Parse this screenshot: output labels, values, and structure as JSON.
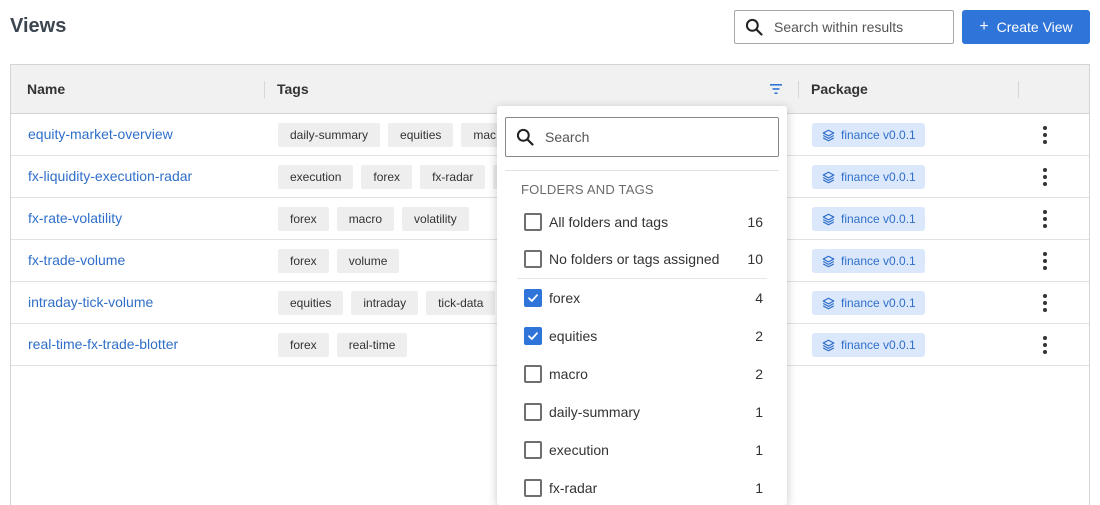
{
  "page": {
    "title": "Views"
  },
  "search": {
    "placeholder": "Search within results"
  },
  "create_button": {
    "label": "Create View",
    "plus": "+"
  },
  "table": {
    "columns": {
      "name": "Name",
      "tags": "Tags",
      "package": "Package"
    },
    "rows": [
      {
        "name": "equity-market-overview",
        "tags": [
          "daily-summary",
          "equities",
          "mac"
        ],
        "package": "finance v0.0.1"
      },
      {
        "name": "fx-liquidity-execution-radar",
        "tags": [
          "execution",
          "forex",
          "fx-radar",
          ""
        ],
        "package": "finance v0.0.1"
      },
      {
        "name": "fx-rate-volatility",
        "tags": [
          "forex",
          "macro",
          "volatility"
        ],
        "package": "finance v0.0.1"
      },
      {
        "name": "fx-trade-volume",
        "tags": [
          "forex",
          "volume"
        ],
        "package": "finance v0.0.1"
      },
      {
        "name": "intraday-tick-volume",
        "tags": [
          "equities",
          "intraday",
          "tick-data"
        ],
        "package": "finance v0.0.1"
      },
      {
        "name": "real-time-fx-trade-blotter",
        "tags": [
          "forex",
          "real-time"
        ],
        "package": "finance v0.0.1"
      }
    ]
  },
  "filter_dropdown": {
    "search_placeholder": "Search",
    "heading": "FOLDERS AND TAGS",
    "options": [
      {
        "label": "All folders and tags",
        "count": "16",
        "checked": false
      },
      {
        "label": "No folders or tags assigned",
        "count": "10",
        "checked": false
      },
      {
        "label": "forex",
        "count": "4",
        "checked": true
      },
      {
        "label": "equities",
        "count": "2",
        "checked": true
      },
      {
        "label": "macro",
        "count": "2",
        "checked": false
      },
      {
        "label": "daily-summary",
        "count": "1",
        "checked": false
      },
      {
        "label": "execution",
        "count": "1",
        "checked": false
      },
      {
        "label": "fx-radar",
        "count": "1",
        "checked": false
      }
    ]
  },
  "icons": {
    "search": "search-icon",
    "filter": "filter-icon",
    "package": "layers-icon",
    "row_menu": "more-vertical-icon",
    "checkbox_checked": "check-icon"
  },
  "colors": {
    "accent": "#2f74d8",
    "link": "#2f6fc9",
    "header_bg": "#f1f1f1",
    "tag_bg": "#eeeeee",
    "package_bg": "#dbe8fb"
  }
}
